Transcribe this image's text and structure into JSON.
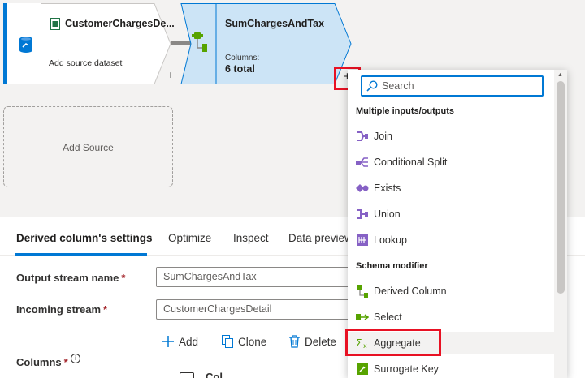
{
  "flow": {
    "source_node": {
      "title": "CustomerChargesDe...",
      "subtitle": "Add source dataset",
      "plus": "+"
    },
    "transform_node": {
      "title": "SumChargesAndTax",
      "columns_label": "Columns:",
      "columns_value": "6 total",
      "plus": "+"
    },
    "add_source": "Add Source"
  },
  "panel": {
    "tabs": [
      {
        "label": "Derived column's settings",
        "active": true
      },
      {
        "label": "Optimize"
      },
      {
        "label": "Inspect"
      },
      {
        "label": "Data preview"
      }
    ],
    "output_stream_label": "Output stream name",
    "output_stream_value": "SumChargesAndTax",
    "incoming_stream_label": "Incoming stream",
    "incoming_stream_value": "CustomerChargesDetail",
    "required_mark": "*",
    "toolbar": {
      "add": "Add",
      "clone": "Clone",
      "delete": "Delete"
    },
    "columns_label": "Columns",
    "columns_cut_text": "Col"
  },
  "dropdown": {
    "search_placeholder": "Search",
    "sections": [
      {
        "title": "Multiple inputs/outputs",
        "items": [
          {
            "label": "Join",
            "icon": "join-icon"
          },
          {
            "label": "Conditional Split",
            "icon": "conditional-split-icon"
          },
          {
            "label": "Exists",
            "icon": "exists-icon"
          },
          {
            "label": "Union",
            "icon": "union-icon"
          },
          {
            "label": "Lookup",
            "icon": "lookup-icon"
          }
        ]
      },
      {
        "title": "Schema modifier",
        "items": [
          {
            "label": "Derived Column",
            "icon": "derived-column-icon"
          },
          {
            "label": "Select",
            "icon": "select-icon"
          },
          {
            "label": "Aggregate",
            "icon": "aggregate-icon",
            "highlighted": true
          },
          {
            "label": "Surrogate Key",
            "icon": "surrogate-key-icon"
          }
        ]
      }
    ]
  },
  "colors": {
    "accent": "#0078d4",
    "highlight_box": "#e81123",
    "purple_icon": "#8661c5",
    "green_icon": "#57a300"
  }
}
